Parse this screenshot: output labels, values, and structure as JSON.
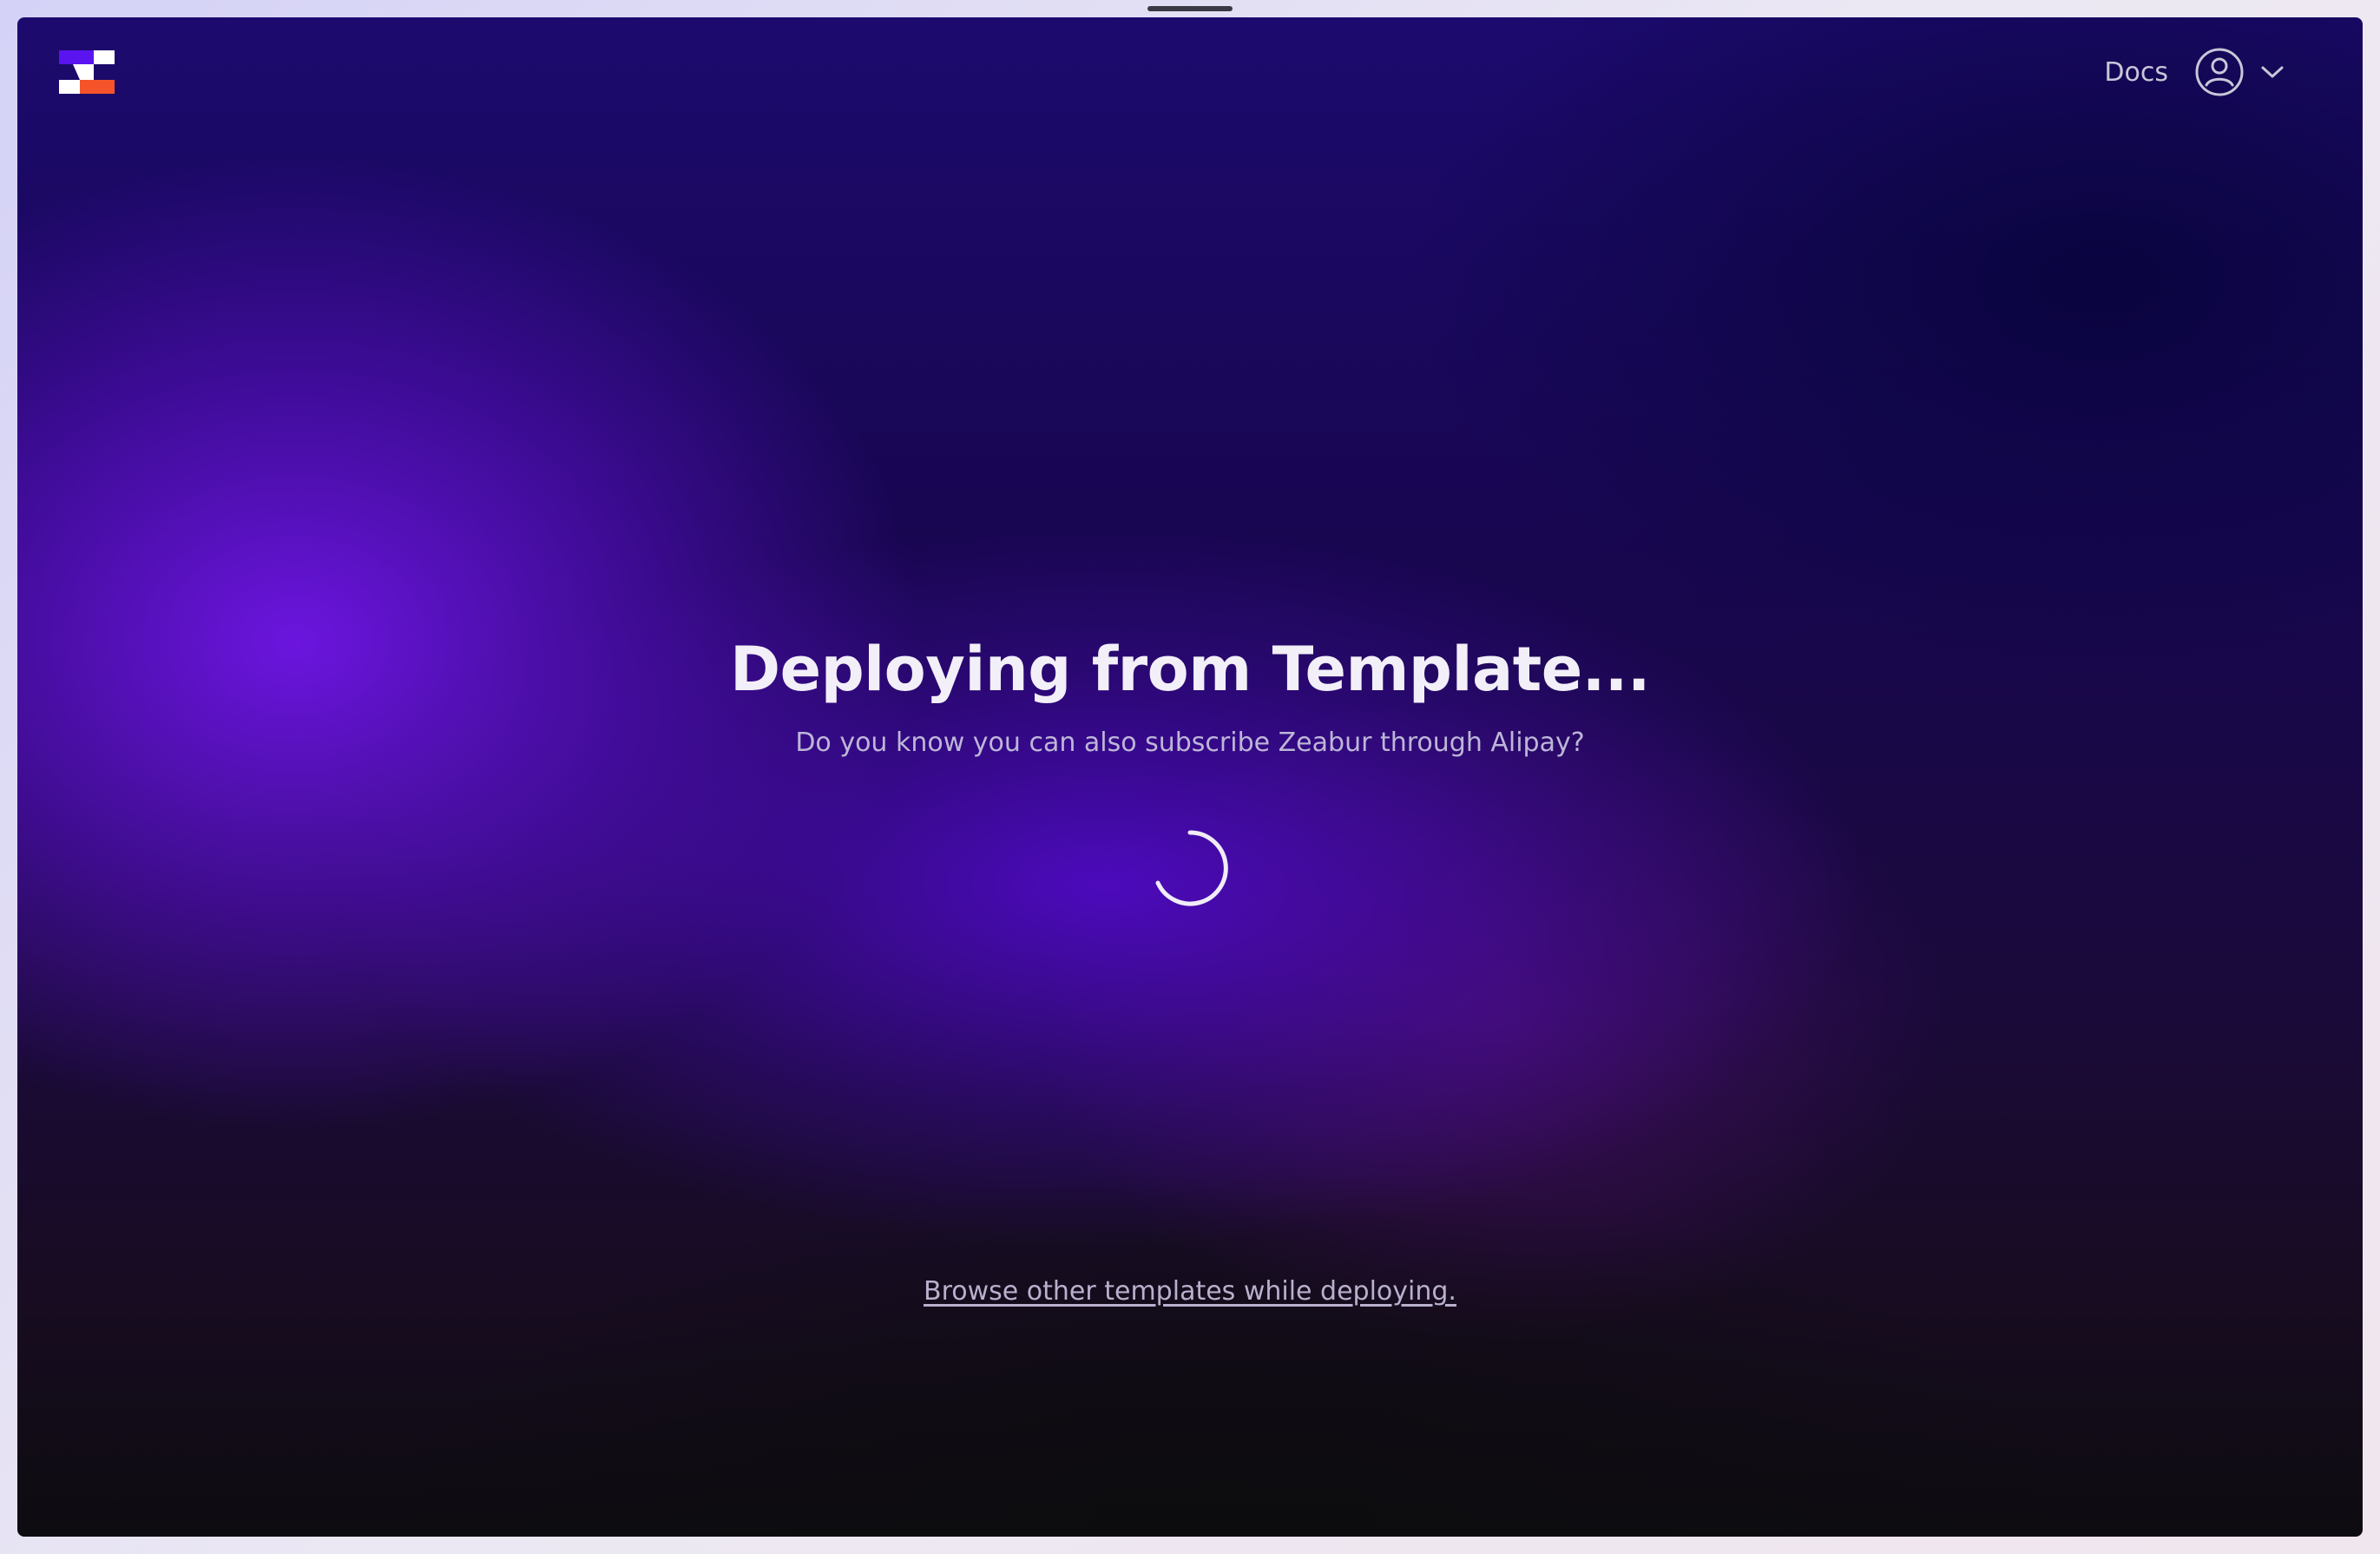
{
  "window": {
    "background_accent": "#6a10e0",
    "background_dark": "#0d0c10"
  },
  "header": {
    "logo_icon": "zeabur-logo-icon",
    "docs_label": "Docs",
    "avatar_icon": "user-circle-icon",
    "dropdown_icon": "chevron-down-icon"
  },
  "main": {
    "title": "Deploying from Template...",
    "subtitle": "Do you know you can also subscribe Zeabur through Alipay?",
    "spinner_icon": "loading-spinner-icon",
    "browse_link": "Browse other templates while deploying."
  },
  "colors": {
    "logo_purple": "#5a14f0",
    "logo_orange": "#f5542a",
    "logo_white": "#ffffff"
  }
}
